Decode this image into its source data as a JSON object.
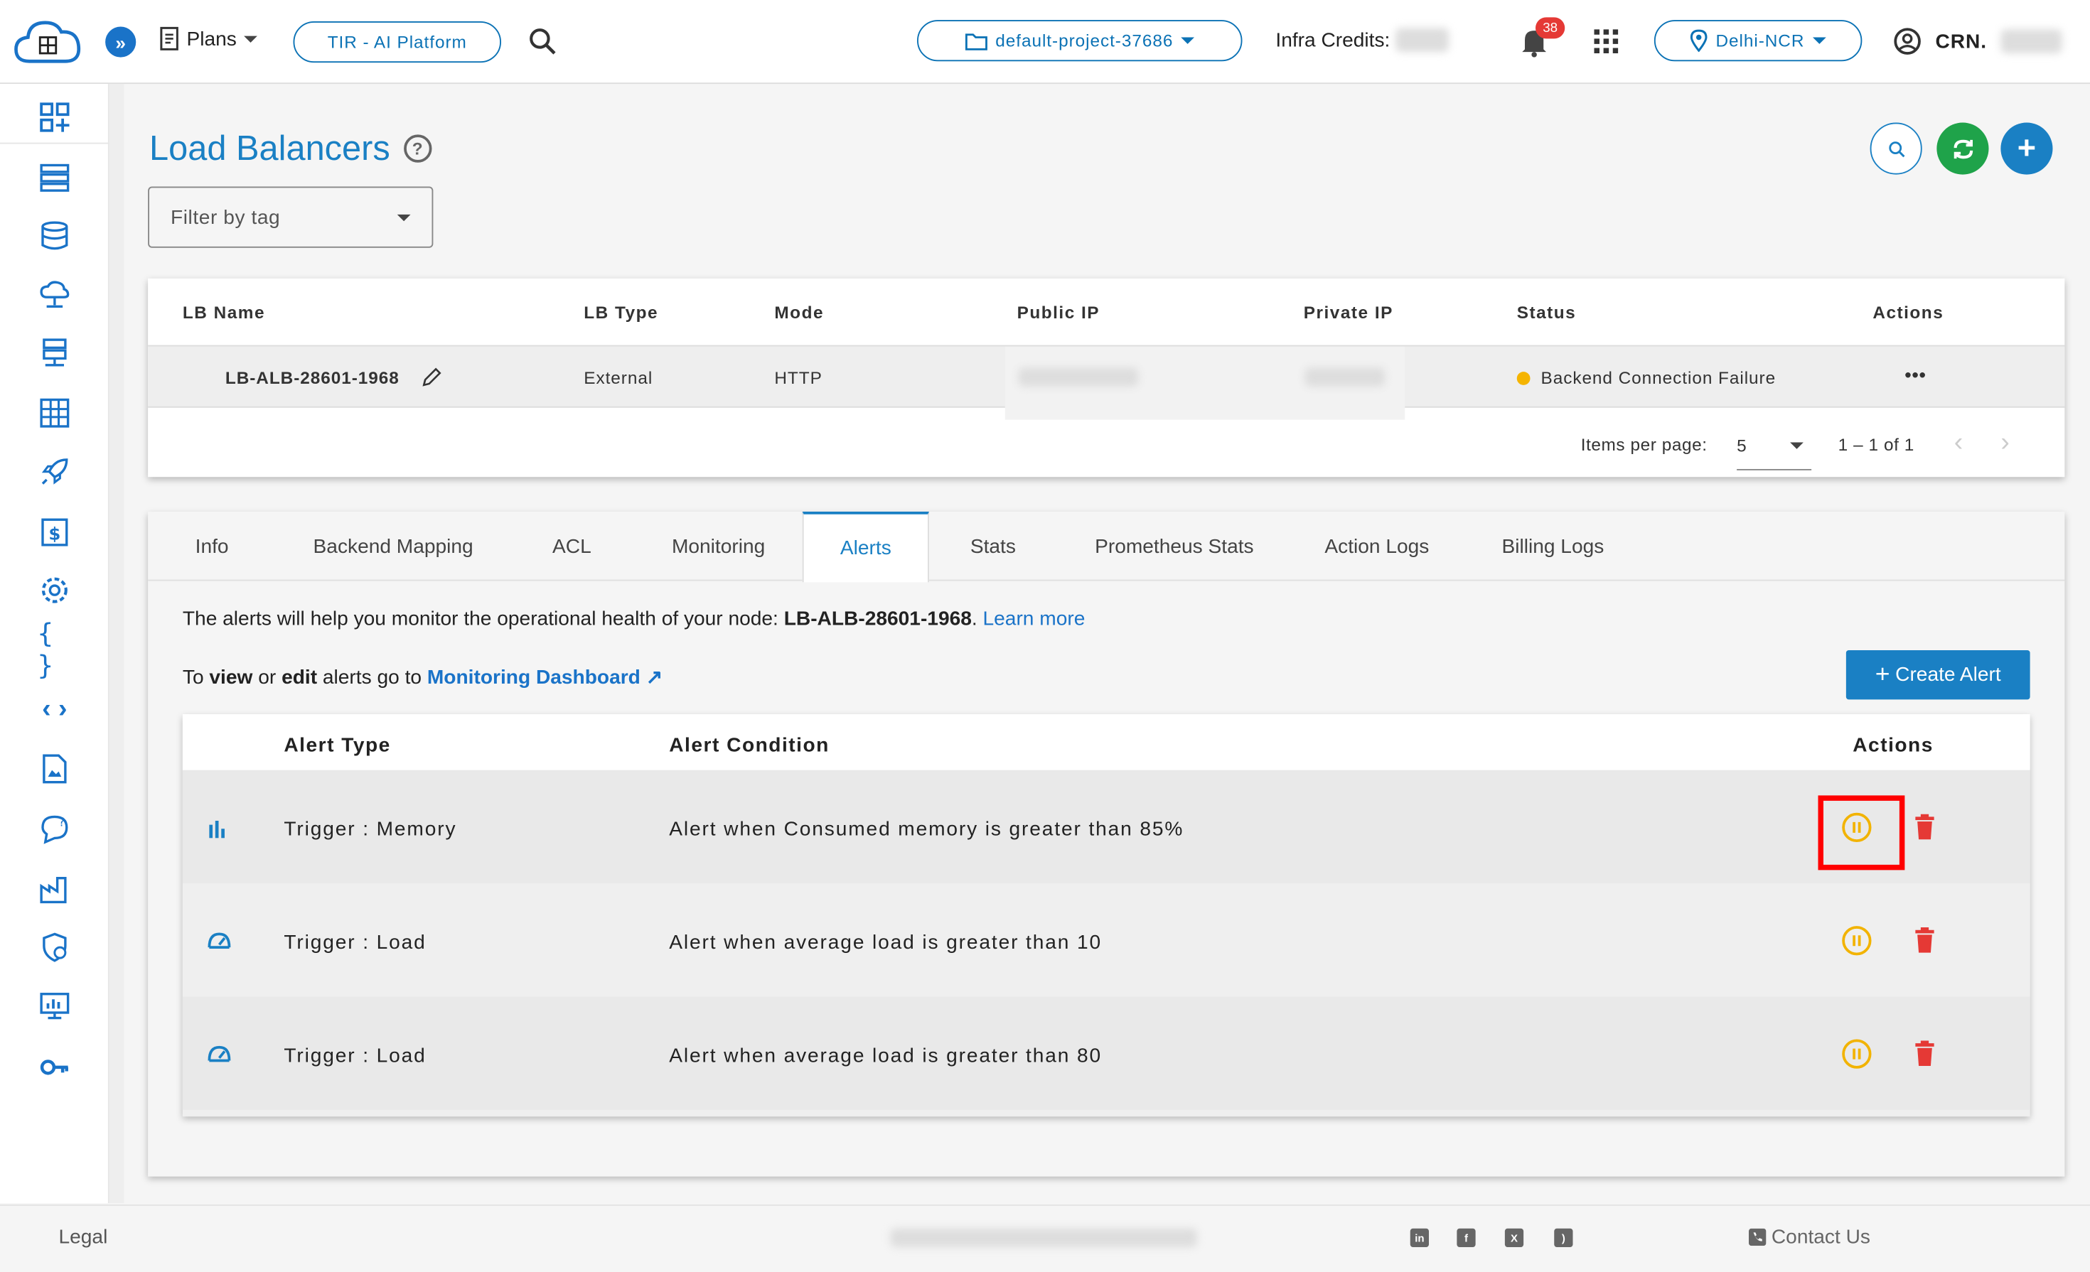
{
  "header": {
    "plans_label": "Plans",
    "tir_label": "TIR - AI Platform",
    "project_label": "default-project-37686",
    "credits_label": "Infra Credits:",
    "notifications_count": "38",
    "region_label": "Delhi-NCR",
    "crn_label": "CRN."
  },
  "page": {
    "title": "Load Balancers",
    "filter_placeholder": "Filter by tag"
  },
  "lb_table": {
    "columns": [
      "LB Name",
      "LB Type",
      "Mode",
      "Public IP",
      "Private IP",
      "Status",
      "Actions"
    ],
    "rows": [
      {
        "name": "LB-ALB-28601-1968",
        "type": "External",
        "mode": "HTTP",
        "status": "Backend Connection Failure",
        "actions": "•••"
      }
    ],
    "items_per_page_label": "Items per page:",
    "items_per_page_value": "5",
    "range_label": "1 – 1 of 1"
  },
  "tabs": [
    "Info",
    "Backend Mapping",
    "ACL",
    "Monitoring",
    "Alerts",
    "Stats",
    "Prometheus Stats",
    "Action Logs",
    "Billing Logs"
  ],
  "alerts": {
    "info_prefix": "The alerts will help you monitor the operational health of your node:",
    "node_name": "LB-ALB-28601-1968",
    "learn_more": "Learn more",
    "view_to": "To",
    "view_word": "view",
    "or_word": "or",
    "edit_word": "edit",
    "go_to": "alerts go to",
    "dashboard_link": "Monitoring Dashboard",
    "create_button": "Create Alert",
    "columns": {
      "type": "Alert Type",
      "condition": "Alert Condition",
      "actions": "Actions"
    },
    "rows": [
      {
        "type": "Trigger : Memory",
        "condition": "Alert when Consumed memory is greater than 85%",
        "icon": "bar-chart-icon"
      },
      {
        "type": "Trigger : Load",
        "condition": "Alert when average load is greater than 10",
        "icon": "gauge-icon"
      },
      {
        "type": "Trigger : Load",
        "condition": "Alert when average load is greater than 80",
        "icon": "gauge-icon"
      }
    ]
  },
  "footer": {
    "legal": "Legal",
    "contact": "Contact Us"
  },
  "colors": {
    "primary": "#1a80c4",
    "success": "#1fa34a",
    "warning": "#f2b300",
    "danger": "#e53935"
  }
}
